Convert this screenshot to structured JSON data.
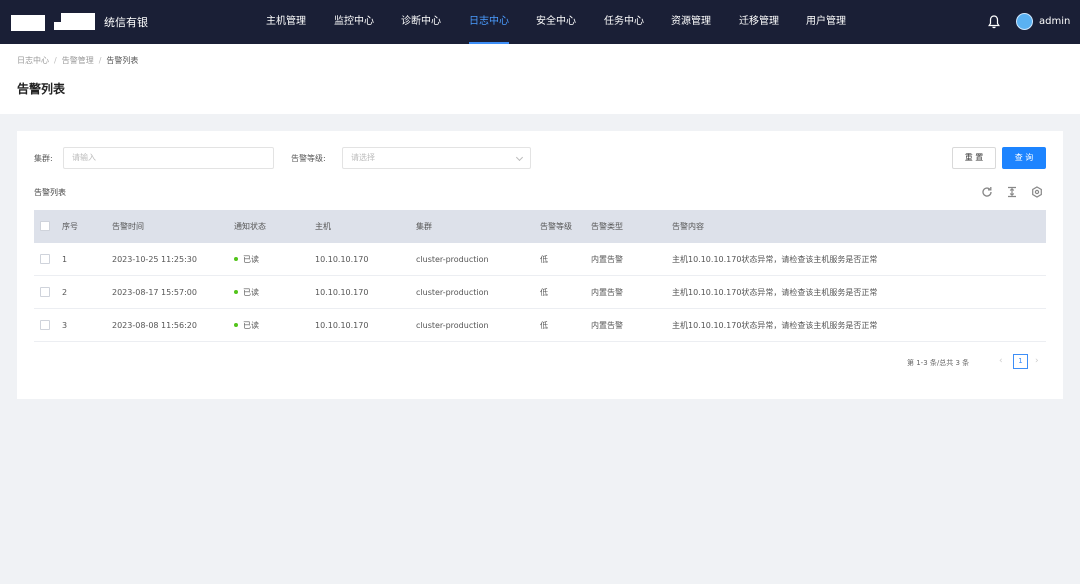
{
  "header": {
    "brand": "统信有银",
    "user": "admin",
    "nav": [
      "主机管理",
      "监控中心",
      "诊断中心",
      "日志中心",
      "安全中心",
      "任务中心",
      "资源管理",
      "迁移管理",
      "用户管理"
    ],
    "active_nav": "日志中心"
  },
  "breadcrumb": [
    "日志中心",
    "告警管理",
    "告警列表"
  ],
  "page_title": "告警列表",
  "filters": {
    "cluster_label": "集群:",
    "cluster_placeholder": "请输入",
    "level_label": "告警等级:",
    "level_placeholder": "请选择",
    "reset_label": "重 置",
    "search_label": "查 询"
  },
  "section_title": "告警列表",
  "table": {
    "headers": [
      "序号",
      "告警时间",
      "通知状态",
      "主机",
      "集群",
      "告警等级",
      "告警类型",
      "告警内容"
    ],
    "rows": [
      {
        "no": "1",
        "time": "2023-10-25 11:25:30",
        "status": "已读",
        "host": "10.10.10.170",
        "cluster": "cluster-production",
        "level": "低",
        "type": "内置告警",
        "content": "主机10.10.10.170状态异常，请检查该主机服务是否正常"
      },
      {
        "no": "2",
        "time": "2023-08-17 15:57:00",
        "status": "已读",
        "host": "10.10.10.170",
        "cluster": "cluster-production",
        "level": "低",
        "type": "内置告警",
        "content": "主机10.10.10.170状态异常，请检查该主机服务是否正常"
      },
      {
        "no": "3",
        "time": "2023-08-08 11:56:20",
        "status": "已读",
        "host": "10.10.10.170",
        "cluster": "cluster-production",
        "level": "低",
        "type": "内置告警",
        "content": "主机10.10.10.170状态异常，请检查该主机服务是否正常"
      }
    ]
  },
  "pagination": {
    "summary": "第 1-3 条/总共 3 条",
    "current_page": "1"
  },
  "colors": {
    "topbar": "#1a1f36",
    "accent": "#1d84ff",
    "status_read": "#52c41a"
  }
}
